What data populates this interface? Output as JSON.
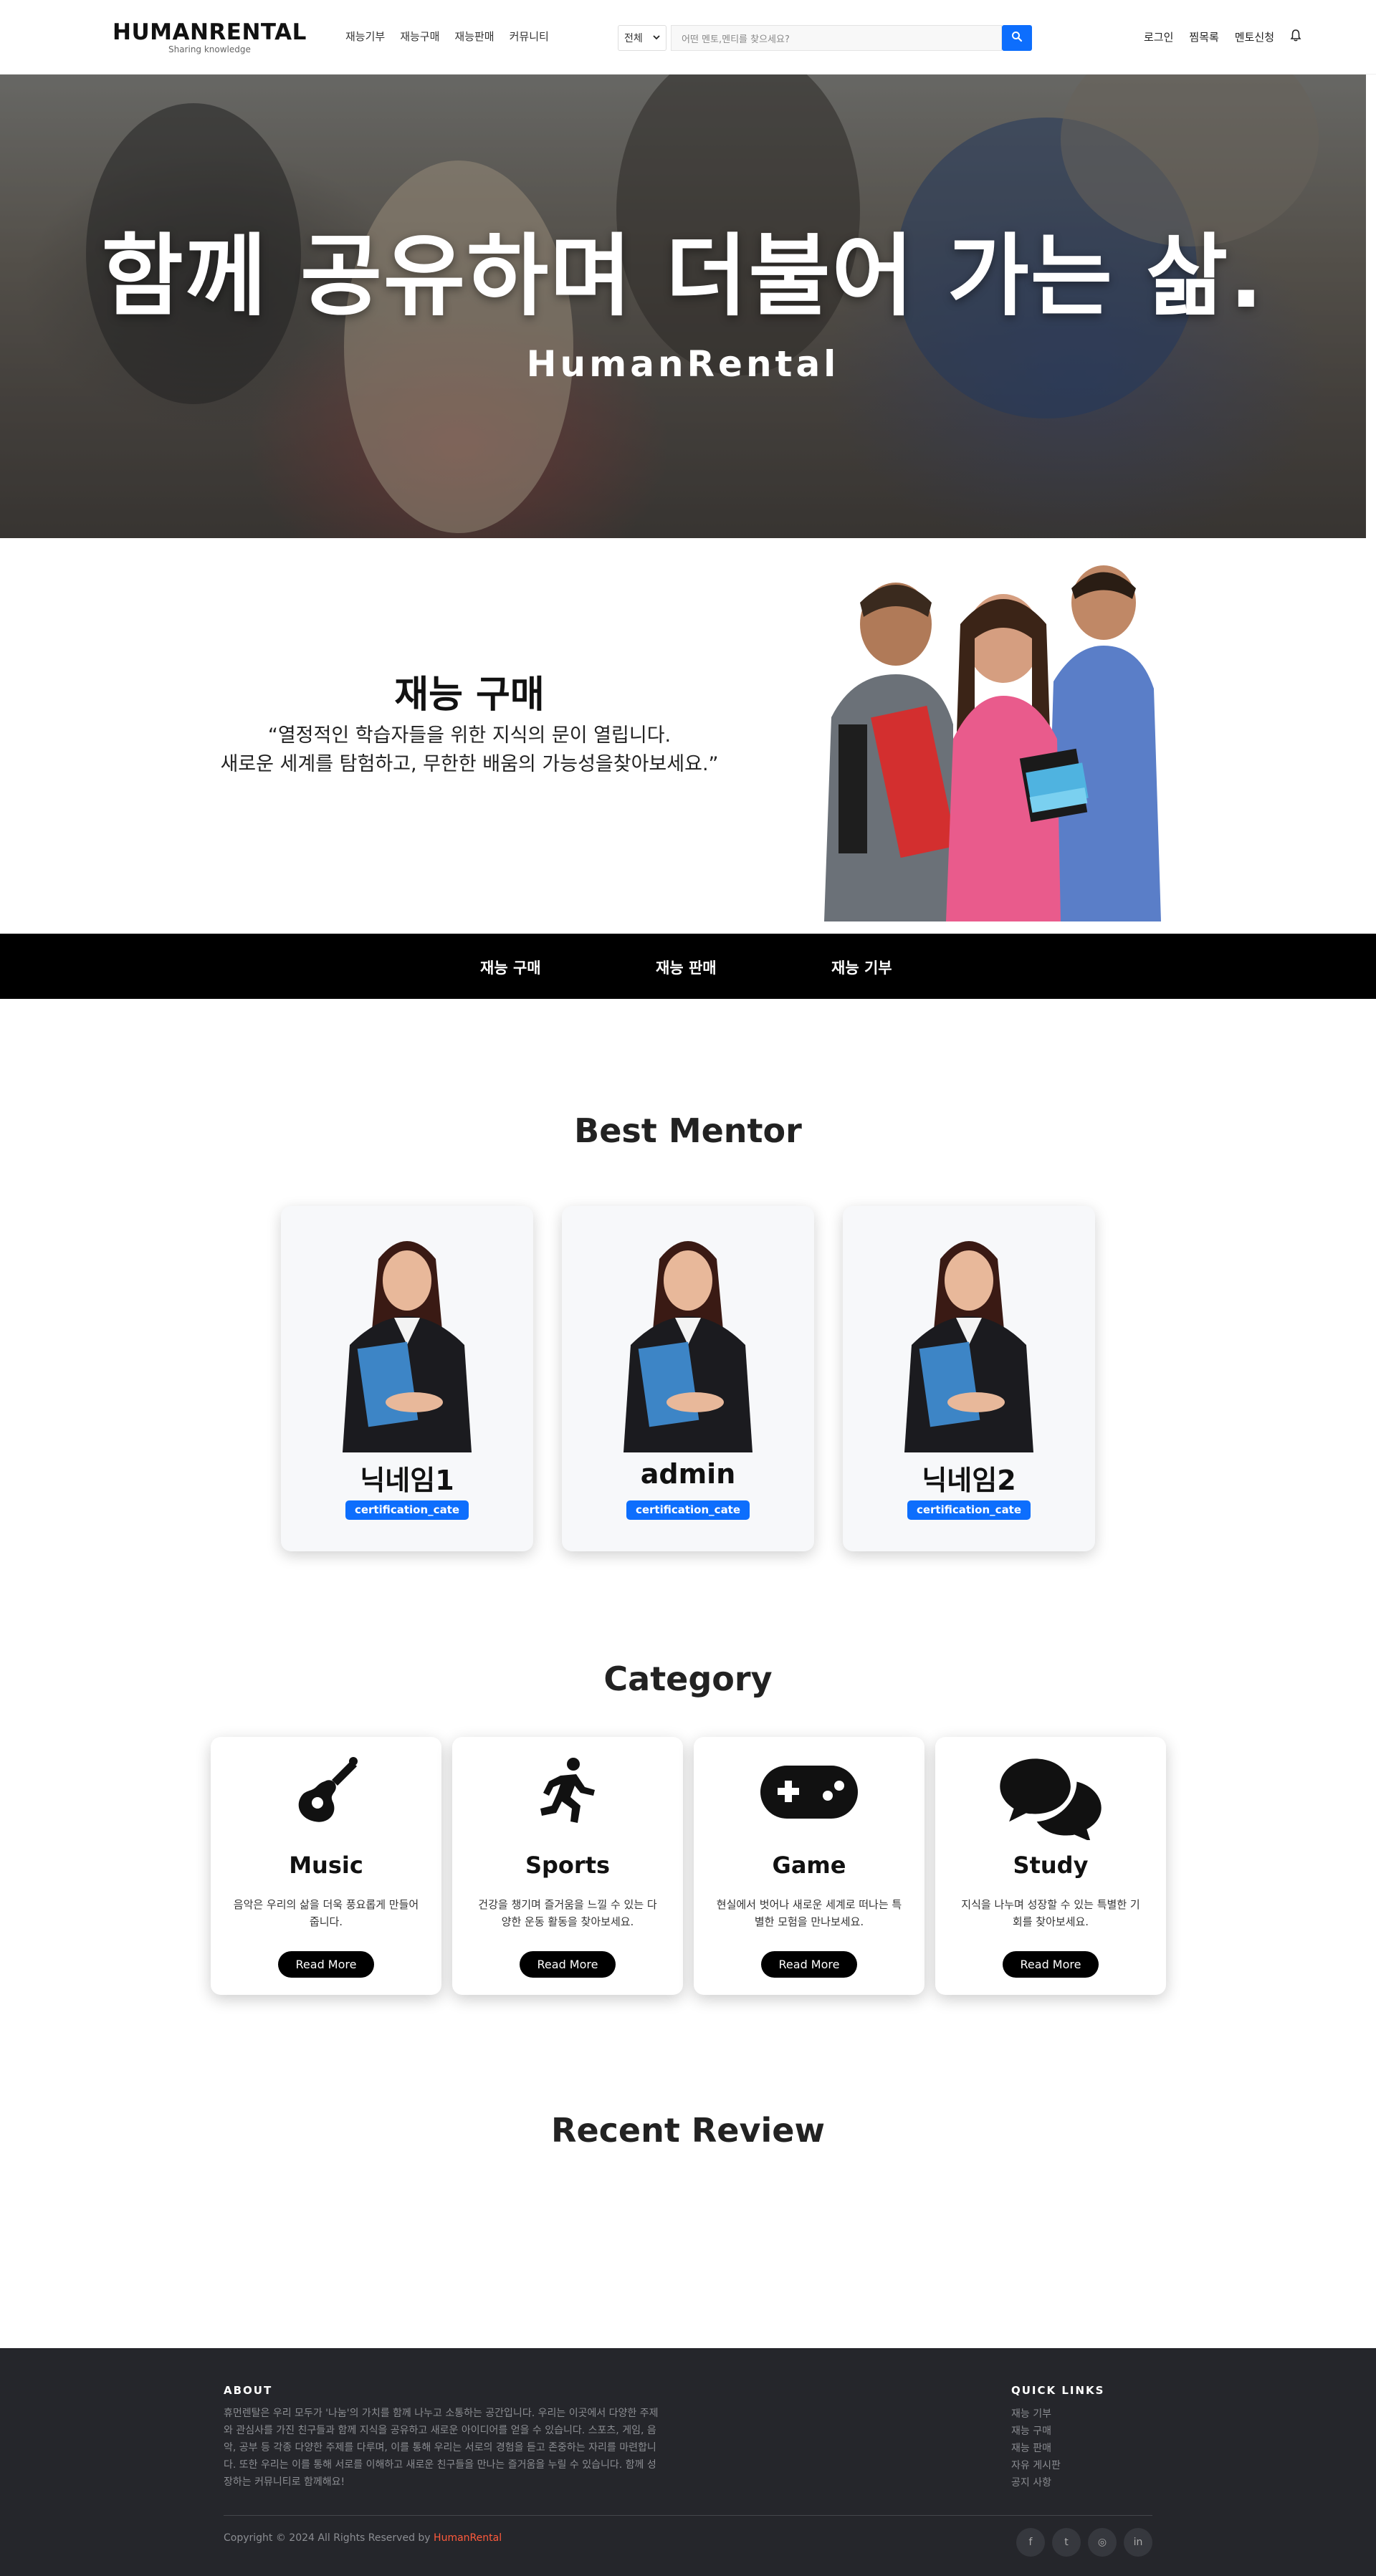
{
  "header": {
    "brand": "HUMANRENTAL",
    "tagline": "Sharing knowledge",
    "nav": [
      "재능기부",
      "재능구매",
      "재능판매",
      "커뮤니티"
    ],
    "search_select": "전체",
    "search_placeholder": "어떤 멘토,멘티를 찾으세요?",
    "right_links": [
      "로그인",
      "찜목록",
      "멘토신청"
    ]
  },
  "hero": {
    "title": "함께 공유하며 더불어 가는 삶.",
    "subtitle": "HumanRental"
  },
  "purchase": {
    "title": "재능 구매",
    "quote_line1": "“열정적인 학습자들을 위한 지식의 문이 열립니다.",
    "quote_line2": "새로운 세계를 탐험하고, 무한한 배움의 가능성을찾아보세요.”"
  },
  "tabs": [
    "재능 구매",
    "재능 판매",
    "재능 기부"
  ],
  "best_mentor": {
    "title": "Best Mentor",
    "mentors": [
      {
        "name": "닉네임1",
        "badge": "certification_cate"
      },
      {
        "name": "admin",
        "badge": "certification_cate"
      },
      {
        "name": "닉네임2",
        "badge": "certification_cate"
      }
    ]
  },
  "category": {
    "title": "Category",
    "items": [
      {
        "title": "Music",
        "icon": "guitar-icon",
        "desc": "음악은 우리의 삶을 더욱 풍요롭게 만들어줍니다.",
        "button": "Read More"
      },
      {
        "title": "Sports",
        "icon": "running-icon",
        "desc": "건강을 챙기며 즐거움을 느낄 수 있는 다양한 운동 활동을 찾아보세요.",
        "button": "Read More"
      },
      {
        "title": "Game",
        "icon": "gamepad-icon",
        "desc": "현실에서 벗어나 새로운 세계로 떠나는 특별한 모험을 만나보세요.",
        "button": "Read More"
      },
      {
        "title": "Study",
        "icon": "comments-icon",
        "desc": "지식을 나누며 성장할 수 있는 특별한 기회를 찾아보세요.",
        "button": "Read More"
      }
    ]
  },
  "recent_review": {
    "title": "Recent Review"
  },
  "footer": {
    "about_heading": "ABOUT",
    "about_text": "휴먼렌탈은 우리 모두가 '나눔'의 가치를 함께 나누고 소통하는 공간입니다. 우리는 이곳에서 다양한 주제와 관심사를 가진 친구들과 함께 지식을 공유하고 새로운 아이디어를 얻을 수 있습니다. 스포츠, 게임, 음악, 공부 등 각종 다양한 주제를 다루며, 이를 통해 우리는 서로의 경험을 듣고 존중하는 자리를 마련합니다. 또한 우리는 이를 통해 서로를 이해하고 새로운 친구들을 만나는 즐거움을 누릴 수 있습니다. 함께 성장하는 커뮤니티로 함께해요!",
    "quick_heading": "QUICK LINKS",
    "quick_links": [
      "재능 기부",
      "재능 구매",
      "재능 판매",
      "자유 게시판",
      "공지 사항"
    ],
    "copyright_prefix": "Copyright © 2024 All Rights Reserved by ",
    "copyright_brand": "HumanRental",
    "social": [
      "f",
      "t",
      "◎",
      "in"
    ],
    "accent_color": "#ff5a3c"
  },
  "colors": {
    "primary": "#0d6efd",
    "tabbar": "#000000",
    "footer_bg": "#25262b"
  }
}
